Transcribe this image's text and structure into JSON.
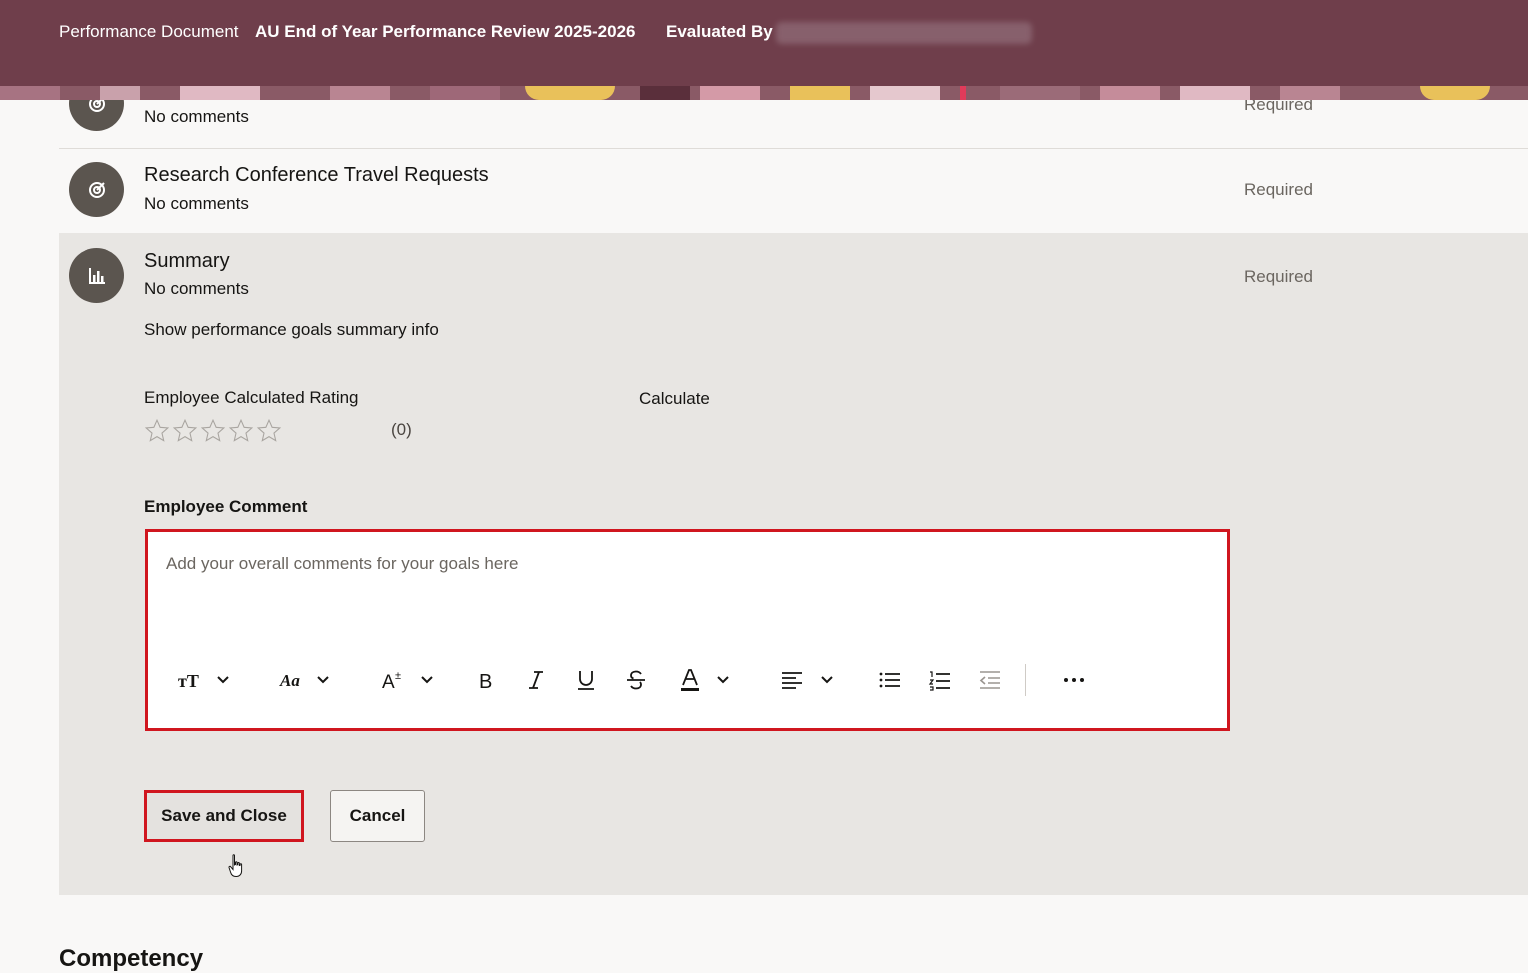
{
  "header": {
    "doc_label": "Performance Document",
    "doc_title": "AU End of Year Performance Review 2025-2026",
    "evaluated_label": "Evaluated By",
    "background_color": "#6f3e4b"
  },
  "goals": [
    {
      "title": "",
      "comment": "No comments",
      "status": "Required",
      "icon": "target-icon"
    },
    {
      "title": "Research Conference Travel Requests",
      "comment": "No comments",
      "status": "Required",
      "icon": "target-icon"
    }
  ],
  "summary": {
    "title": "Summary",
    "comment": "No comments",
    "status": "Required",
    "icon": "chart-icon",
    "show_info_link": "Show performance goals summary info",
    "rating_label": "Employee Calculated Rating",
    "calculate_link": "Calculate",
    "rating_count": "(0)",
    "rating_stars_filled": 0,
    "rating_stars_total": 5,
    "comment_label": "Employee Comment",
    "comment_placeholder": "Add your overall comments for your goals here",
    "toolbar": [
      "text-size-icon",
      "font-family-icon",
      "font-size-icon",
      "bold-icon",
      "italic-icon",
      "underline-icon",
      "strikethrough-icon",
      "font-color-icon",
      "align-icon",
      "bullet-list-icon",
      "numbered-list-icon",
      "outdent-icon",
      "more-icon"
    ]
  },
  "actions": {
    "save_label": "Save and Close",
    "cancel_label": "Cancel"
  },
  "next_section": "Competency",
  "colors": {
    "link": "#1a6394",
    "highlight_border": "#d0161f"
  }
}
